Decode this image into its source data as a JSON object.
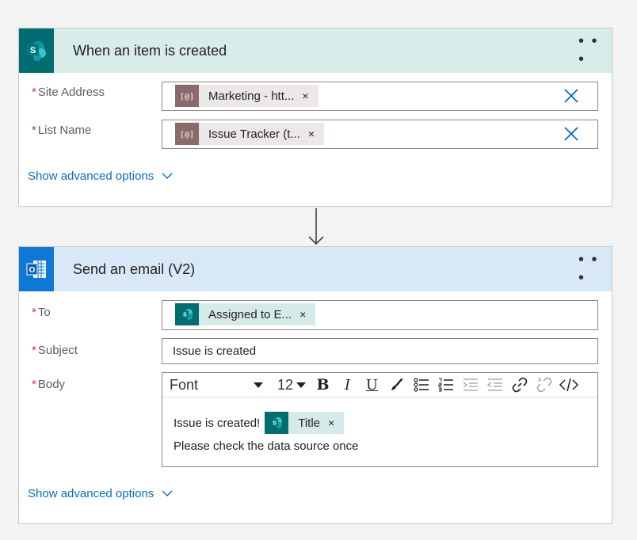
{
  "trigger": {
    "title": "When an item is created",
    "more_label": "• • •",
    "fields": {
      "site_address": {
        "label": "Site Address",
        "token": "Marketing - htt..."
      },
      "list_name": {
        "label": "List Name",
        "token": "Issue Tracker (t..."
      }
    },
    "show_advanced": "Show advanced options"
  },
  "action": {
    "title": "Send an email (V2)",
    "more_label": "• • •",
    "fields": {
      "to": {
        "label": "To",
        "token": "Assigned to E..."
      },
      "subject": {
        "label": "Subject",
        "value": "Issue is created"
      },
      "body": {
        "label": "Body",
        "font": "Font",
        "size": "12",
        "line1_text": "Issue is created!",
        "line1_token": "Title",
        "line2_text": "Please check the data source once"
      }
    },
    "show_advanced": "Show advanced options"
  },
  "required_mark": "*",
  "token_close": "×",
  "colors": {
    "sharepoint": "#036c70",
    "outlook": "#0f78d4",
    "link": "#0f6cbd",
    "required": "#d13438"
  }
}
